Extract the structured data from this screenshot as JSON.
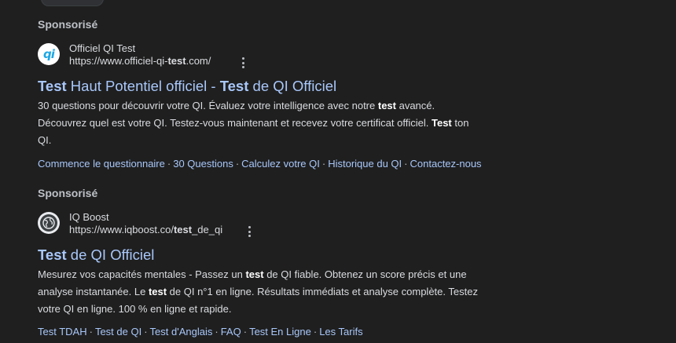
{
  "ads": [
    {
      "sponsored_label": "Sponsorisé",
      "site_name": "Officiel QI Test",
      "url_prefix": "https://www.officiel-qi-",
      "url_bold": "test",
      "url_suffix": ".com/",
      "favicon_text": "qi",
      "favicon_icon": "qi-logo-icon",
      "title": [
        {
          "text": "Test",
          "bold": true
        },
        {
          "text": " Haut Potentiel officiel - ",
          "bold": false
        },
        {
          "text": "Test",
          "bold": true
        },
        {
          "text": " de QI Officiel",
          "bold": false
        }
      ],
      "description_lines": [
        [
          {
            "text": "30 questions pour découvrir votre QI. Évaluez votre intelligence avec notre ",
            "bold": false
          },
          {
            "text": "test",
            "bold": true
          },
          {
            "text": " avancé.",
            "bold": false
          }
        ],
        [
          {
            "text": "Découvrez quel est votre QI. Testez-vous maintenant et recevez votre certificat officiel. ",
            "bold": false
          },
          {
            "text": "Test",
            "bold": true
          },
          {
            "text": " ton",
            "bold": false
          }
        ],
        [
          {
            "text": "QI.",
            "bold": false
          }
        ]
      ],
      "sitelinks": [
        "Commence le questionnaire",
        "30 Questions",
        "Calculez votre QI",
        "Historique du QI",
        "Contactez-nous"
      ]
    },
    {
      "sponsored_label": "Sponsorisé",
      "site_name": "IQ Boost",
      "url_prefix": "https://www.iqboost.co/",
      "url_bold": "test",
      "url_suffix": "_de_qi",
      "favicon_icon": "globe-icon",
      "title": [
        {
          "text": "Test",
          "bold": true
        },
        {
          "text": " de QI Officiel",
          "bold": false
        }
      ],
      "description_lines": [
        [
          {
            "text": "Mesurez vos capacités mentales - Passez un ",
            "bold": false
          },
          {
            "text": "test",
            "bold": true
          },
          {
            "text": " de QI fiable. Obtenez un score précis et une",
            "bold": false
          }
        ],
        [
          {
            "text": "analyse instantanée. Le ",
            "bold": false
          },
          {
            "text": "test",
            "bold": true
          },
          {
            "text": " de QI n°1 en ligne. Résultats immédiats et analyse complète. Testez",
            "bold": false
          }
        ],
        [
          {
            "text": "votre QI en ligne. 100 % en ligne et rapide.",
            "bold": false
          }
        ]
      ],
      "sitelinks": [
        "Test TDAH",
        "Test de QI",
        "Test d'Anglais",
        "FAQ",
        "Test En Ligne",
        "Les Tarifs"
      ]
    }
  ],
  "sitelink_separator": "·",
  "colors": {
    "background": "#1f1f1f",
    "link": "#a8c7fa",
    "text": "#dadce0",
    "muted": "#bdc1c6"
  }
}
